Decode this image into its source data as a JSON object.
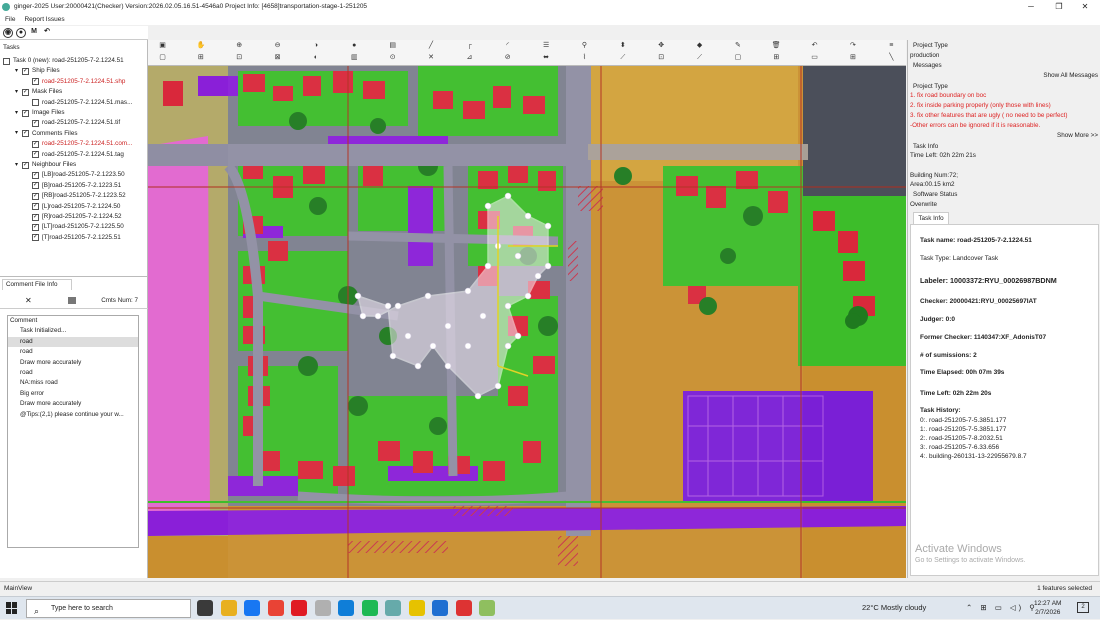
{
  "titlebar": {
    "title": "ginger-2025   User:20000421(Checker)   Version:2026.02.05.16.51-4546a0   Project Info: [4658]transportation-stage-1-251205",
    "minimize": "─",
    "maximize": "❐",
    "close": "✕"
  },
  "menu": {
    "file": "File",
    "report_issues": "Report Issues"
  },
  "small_toolbar": [
    "◉",
    "●",
    "M",
    "↶"
  ],
  "left_panel": {
    "header": "Tasks",
    "tree": [
      {
        "label": "Task 0 (new): road-251205-7-2.1224.51",
        "indent": 0,
        "toggle": "☐",
        "checkbox": "",
        "red": false
      },
      {
        "label": "Ship Files",
        "indent": 1,
        "toggle": "▾",
        "checkbox": "✓",
        "red": false
      },
      {
        "label": "road-251205-7-2.1224.51.shp",
        "indent": 2,
        "toggle": "",
        "checkbox": "✓",
        "red": true
      },
      {
        "label": "Mask Files",
        "indent": 1,
        "toggle": "▾",
        "checkbox": "✓",
        "red": false
      },
      {
        "label": "road-251205-7-2.1224.51.mas...",
        "indent": 2,
        "toggle": "",
        "checkbox": "",
        "red": false
      },
      {
        "label": "Image Files",
        "indent": 1,
        "toggle": "▾",
        "checkbox": "✓",
        "red": false
      },
      {
        "label": "road-251205-7-2.1224.51.tif",
        "indent": 2,
        "toggle": "",
        "checkbox": "✓",
        "red": false
      },
      {
        "label": "Comments Files",
        "indent": 1,
        "toggle": "▾",
        "checkbox": "✓",
        "red": false
      },
      {
        "label": "road-251205-7-2.1224.51.com...",
        "indent": 2,
        "toggle": "",
        "checkbox": "✓",
        "red": true
      },
      {
        "label": "road-251205-7-2.1224.51.tag",
        "indent": 2,
        "toggle": "",
        "checkbox": "✓",
        "red": false
      },
      {
        "label": "Neighbour Files",
        "indent": 1,
        "toggle": "▾",
        "checkbox": "✓",
        "red": false
      },
      {
        "label": "[LB]road-251205-7-2.1223.50",
        "indent": 2,
        "toggle": "",
        "checkbox": "✓",
        "red": false
      },
      {
        "label": "[B]road-251205-7-2.1223.51",
        "indent": 2,
        "toggle": "",
        "checkbox": "✓",
        "red": false
      },
      {
        "label": "[RB]road-251205-7-2.1223.52",
        "indent": 2,
        "toggle": "",
        "checkbox": "✓",
        "red": false
      },
      {
        "label": "[L]road-251205-7-2.1224.50",
        "indent": 2,
        "toggle": "",
        "checkbox": "✓",
        "red": false
      },
      {
        "label": "[R]road-251205-7-2.1224.52",
        "indent": 2,
        "toggle": "",
        "checkbox": "✓",
        "red": false
      },
      {
        "label": "[LT]road-251205-7-2.1225.50",
        "indent": 2,
        "toggle": "",
        "checkbox": "✓",
        "red": false
      },
      {
        "label": "[T]road-251205-7-2.1225.51",
        "indent": 2,
        "toggle": "",
        "checkbox": "✓",
        "red": false
      }
    ]
  },
  "comment_panel": {
    "tab_label": "Comment File Info",
    "close": "✕",
    "count_label": "Cmts Num:  7",
    "column_header": "Comment",
    "items": [
      "Task Initialized...",
      "road",
      "road",
      "Draw more accurately",
      "road",
      "NA:miss road",
      "Big error",
      "Draw more accurately",
      "@Tips:(2,1)  please continue your w..."
    ],
    "selected_index": 1
  },
  "toolbar": {
    "row1": [
      "▣",
      "✋",
      "⊕",
      "⊖",
      "◑",
      "●",
      "▤",
      "╱",
      "┌",
      "◜",
      "☰",
      "⚲",
      "⬍",
      "✥",
      "◆",
      "✎",
      "🗑",
      "↶",
      "↷",
      "≡"
    ],
    "row2": [
      "▢",
      "⊞",
      "⊡",
      "⊠",
      "◐",
      "▥",
      "⊙",
      "✕",
      "⊿",
      "⊘",
      "⬌",
      "⌇",
      "⟋",
      "⊡",
      "⟋",
      "▢",
      "⊞",
      "▭",
      "⊞",
      "╲"
    ]
  },
  "map": {
    "colors": {
      "ground": "#c98f2f",
      "building": "#d9283b",
      "vegetation": "#3dbd2a",
      "water": "#7a1fd6",
      "road": "#8f8ea3",
      "tree": "#1f7a1f",
      "selection": "#ffffff",
      "edit_line": "#e0d21f",
      "grid": "#b02d1f"
    }
  },
  "right_panel": {
    "project_type_label": "Project Type",
    "project_type_value": "production",
    "messages_label": "Messages",
    "show_all_messages": "Show All Messages",
    "project_type_label2": "Project Type",
    "requirements": [
      "1. fix road boundary on boc",
      "2. fix inside parking properly (only those with lines)",
      "3. fix other features that are ugly ( no need to be perfect)",
      "-Other errors can be ignored if it is reasonable."
    ],
    "show_more": "Show More >>",
    "task_info_label": "Task Info",
    "time_left": "Time Left: 02h 22m 21s",
    "building_num": "Building Num:72;",
    "area": "Area:00.15 km2",
    "software_status": "Software Status",
    "overwrite": "Overwrite"
  },
  "task_info": {
    "tab": "Task Info",
    "task_name": "Task name: road-251205-7-2.1224.51",
    "task_type": "Task Type: Landcover Task",
    "labeler": "Labeler: 10003372:RYU_00026987BDNM",
    "checker": "Checker: 20000421:RYU_00025697IAT",
    "judger": "Judger: 0:0",
    "former_checker": "Former Checker: 1140347:XF_AdonisT07",
    "submissions": "# of sumissions: 2",
    "time_elapsed": "Time Elapsed: 00h 07m 39s",
    "time_left": "Time Left: 02h 22m 20s",
    "history_label": "Task History:",
    "history": [
      "0:. road-251205-7-5.3851.177",
      "1:. road-251205-7-5.3851.177",
      "2:. road-251205-7-8.2032.51",
      "3:. road-251205-7-6.33.656",
      "4:. building-260131-13-22955679.8.7"
    ]
  },
  "watermark": {
    "line1": "Activate Windows",
    "line2": "Go to Settings to activate Windows."
  },
  "statusbar": {
    "left": "MainView",
    "right": "1 features selected"
  },
  "taskbar": {
    "search_placeholder": "Type here to search",
    "search_icon": "⌕",
    "app_icon_colors": [
      "#3a3a3a",
      "#e8b020",
      "#1877f2",
      "#e94335",
      "#e01b24",
      "#b0b0b0",
      "#0f7ed8",
      "#1db954",
      "#6aa",
      "#e6c200",
      "#1f6fd1",
      "#d33",
      "#8fbf5f"
    ],
    "weather": "22°C  Mostly cloudy",
    "tray": "⌃ ⊞ ▭ ◁) ⚲",
    "time": "12:27 AM",
    "date": "2/7/2026",
    "notif": "2"
  }
}
